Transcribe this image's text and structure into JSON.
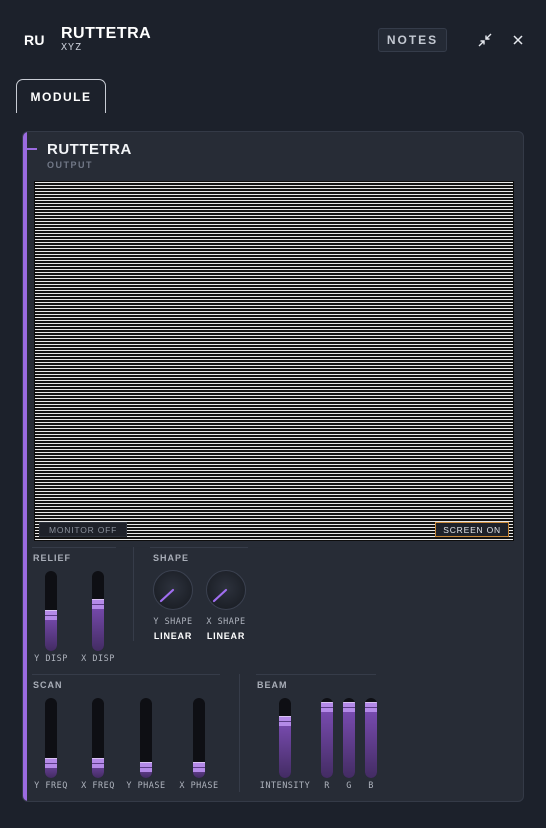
{
  "header": {
    "badge": "RU",
    "title": "RUTTETRA",
    "subtitle": "XYZ",
    "notes_label": "NOTES",
    "icons": [
      "minimize-icon",
      "close-icon"
    ]
  },
  "tabs": [
    {
      "label": "MODULE",
      "active": true
    }
  ],
  "module": {
    "title": "RUTTETRA",
    "subtitle": "OUTPUT",
    "accent_color": "#9b6be0",
    "screen": {
      "monitor_label": "MONITOR OFF",
      "screen_label": "SCREEN ON",
      "screen_on": true
    },
    "relief": {
      "label": "RELIEF",
      "sliders": [
        {
          "label": "Y DISP",
          "value": 0.45
        },
        {
          "label": "X DISP",
          "value": 0.6
        }
      ]
    },
    "shape": {
      "label": "SHAPE",
      "knobs": [
        {
          "label": "Y SHAPE",
          "value": "LINEAR"
        },
        {
          "label": "X SHAPE",
          "value": "LINEAR"
        }
      ]
    },
    "scan": {
      "label": "SCAN",
      "sliders": [
        {
          "label": "Y FREQ",
          "value": 0.15
        },
        {
          "label": "X FREQ",
          "value": 0.15
        },
        {
          "label": "Y PHASE",
          "value": 0.08
        },
        {
          "label": "X PHASE",
          "value": 0.08
        }
      ]
    },
    "beam": {
      "label": "BEAM",
      "sliders": [
        {
          "label": "INTENSITY",
          "value": 0.75
        },
        {
          "label": "R",
          "value": 0.95
        },
        {
          "label": "G",
          "value": 0.95
        },
        {
          "label": "B",
          "value": 0.95
        }
      ]
    }
  }
}
